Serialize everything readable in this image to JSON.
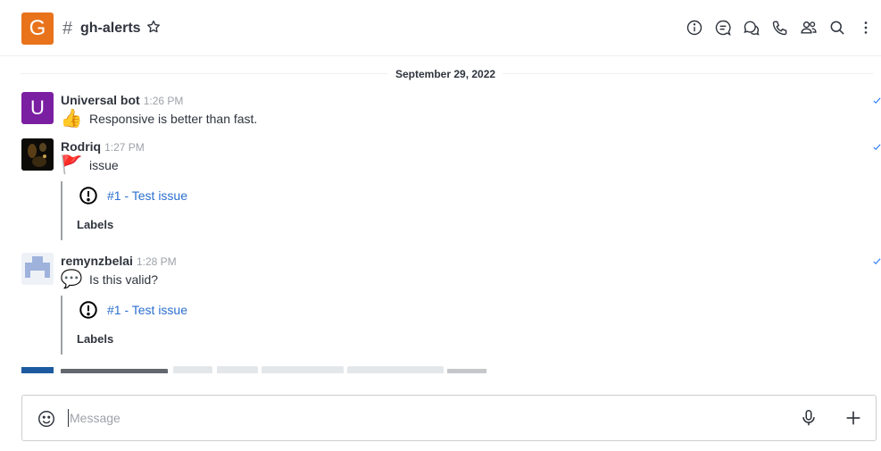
{
  "header": {
    "avatar_letter": "G",
    "hash_symbol": "#",
    "room_name": "gh-alerts",
    "icons": [
      "info-icon",
      "threads-icon",
      "discussion-icon",
      "call-icon",
      "members-icon",
      "search-icon",
      "kebab-icon"
    ]
  },
  "date_divider": "September 29, 2022",
  "messages": [
    {
      "avatar_letter": "U",
      "author": "Universal bot",
      "time": "1:26 PM",
      "emoji": "👍",
      "text": "Responsive is better than fast."
    },
    {
      "author": "Rodriq",
      "time": "1:27 PM",
      "emoji": "🚩",
      "text": "issue",
      "attachment": {
        "title": "#1 - Test issue",
        "labels": "Labels"
      }
    },
    {
      "author": "remynzbelai",
      "time": "1:28 PM",
      "emoji": "💬",
      "text": "Is this valid?",
      "attachment": {
        "title": "#1 - Test issue",
        "labels": "Labels"
      }
    }
  ],
  "composer": {
    "placeholder": "Message"
  },
  "colors": {
    "room_avatar": "#e8731b",
    "bot_avatar": "#7b1fa2",
    "link": "#2b6fce",
    "text": "#2f343d",
    "muted": "#9ea2a8"
  }
}
